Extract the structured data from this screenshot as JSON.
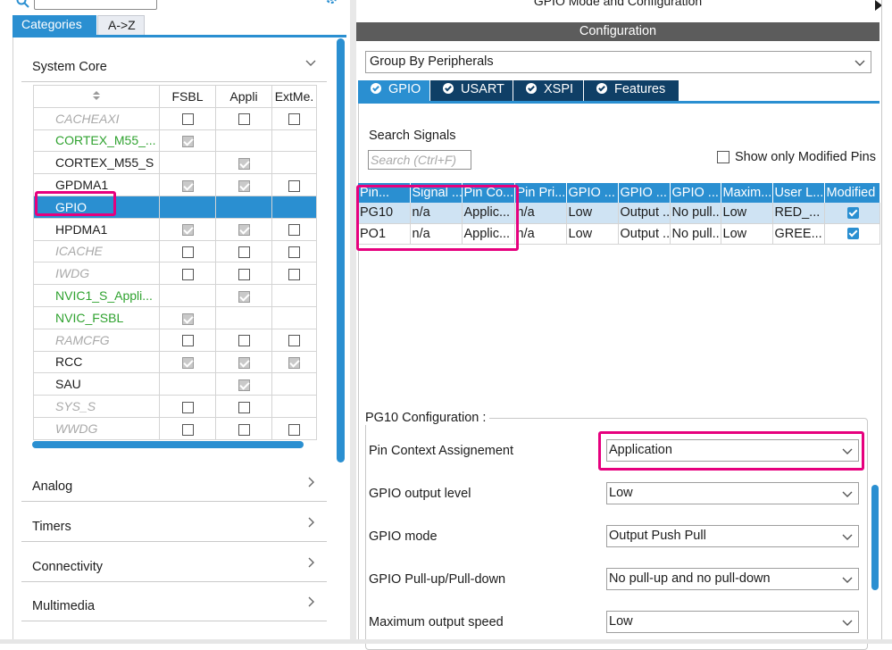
{
  "left": {
    "search_placeholder": "",
    "tabs": [
      "Categories",
      "A->Z"
    ],
    "system_core": "System Core",
    "table": {
      "headers": [
        "",
        "FSBL",
        "Appli",
        "ExtMe."
      ],
      "rows": [
        {
          "name": "CACHEAXI",
          "style": "gray",
          "fsbl": "empty",
          "appli": "empty",
          "ext": "empty"
        },
        {
          "name": "CORTEX_M55_...",
          "style": "green",
          "fsbl": "checked",
          "appli": "",
          "ext": ""
        },
        {
          "name": "CORTEX_M55_S",
          "style": "black",
          "fsbl": "",
          "appli": "checked",
          "ext": ""
        },
        {
          "name": "GPDMA1",
          "style": "black",
          "fsbl": "checked",
          "appli": "checked",
          "ext": "empty"
        },
        {
          "name": "GPIO",
          "style": "selected",
          "fsbl": "",
          "appli": "",
          "ext": ""
        },
        {
          "name": "HPDMA1",
          "style": "black",
          "fsbl": "checked",
          "appli": "checked",
          "ext": "empty"
        },
        {
          "name": "ICACHE",
          "style": "gray",
          "fsbl": "empty",
          "appli": "empty",
          "ext": "empty"
        },
        {
          "name": "IWDG",
          "style": "gray",
          "fsbl": "empty",
          "appli": "empty",
          "ext": "empty"
        },
        {
          "name": "NVIC1_S_Appli...",
          "style": "green",
          "fsbl": "",
          "appli": "checked",
          "ext": ""
        },
        {
          "name": "NVIC_FSBL",
          "style": "green",
          "fsbl": "checked",
          "appli": "",
          "ext": ""
        },
        {
          "name": "RAMCFG",
          "style": "gray",
          "fsbl": "empty",
          "appli": "empty",
          "ext": "empty"
        },
        {
          "name": "RCC",
          "style": "black",
          "fsbl": "checked",
          "appli": "checked",
          "ext": "checked"
        },
        {
          "name": "SAU",
          "style": "black",
          "fsbl": "",
          "appli": "checked",
          "ext": ""
        },
        {
          "name": "SYS_S",
          "style": "gray",
          "fsbl": "empty",
          "appli": "empty",
          "ext": ""
        },
        {
          "name": "WWDG",
          "style": "gray",
          "fsbl": "empty",
          "appli": "empty",
          "ext": "empty"
        }
      ]
    },
    "categories": [
      "Analog",
      "Timers",
      "Connectivity",
      "Multimedia"
    ]
  },
  "right": {
    "mode_title": "GPIO Mode and Configuration",
    "config_title": "Configuration",
    "group_by": "Group By Peripherals",
    "tabs": [
      "GPIO",
      "USART",
      "XSPI",
      "Features"
    ],
    "search_label": "Search Signals",
    "search_placeholder": "Search (Ctrl+F)",
    "modified_label": "Show only Modified Pins",
    "gpio_table": {
      "headers": [
        "Pin...",
        "Signal ...",
        "Pin Co...",
        "Pin Pri...",
        "GPIO ...",
        "GPIO ...",
        "GPIO ...",
        "Maxim...",
        "User L...",
        "Modified"
      ],
      "rows": [
        [
          "PG10",
          "n/a",
          "Applic...",
          "n/a",
          "Low",
          "Output ...",
          "No pull...",
          "Low",
          "RED_..."
        ],
        [
          "PO1",
          "n/a",
          "Applic...",
          "n/a",
          "Low",
          "Output ...",
          "No pull...",
          "Low",
          "GREE..."
        ]
      ]
    },
    "pin_config": {
      "title": "PG10 Configuration :",
      "fields": [
        {
          "label": "Pin Context Assignement",
          "value": "Application"
        },
        {
          "label": "GPIO output level",
          "value": "Low"
        },
        {
          "label": "GPIO mode",
          "value": "Output Push Pull"
        },
        {
          "label": "GPIO Pull-up/Pull-down",
          "value": "No pull-up and no pull-down"
        },
        {
          "label": "Maximum output speed",
          "value": "Low"
        }
      ]
    }
  },
  "colors": {
    "accent": "#2a8fd1",
    "highlight": "#e6007e",
    "dark_tab": "#0f3f66",
    "green_text": "#2fa22f"
  }
}
